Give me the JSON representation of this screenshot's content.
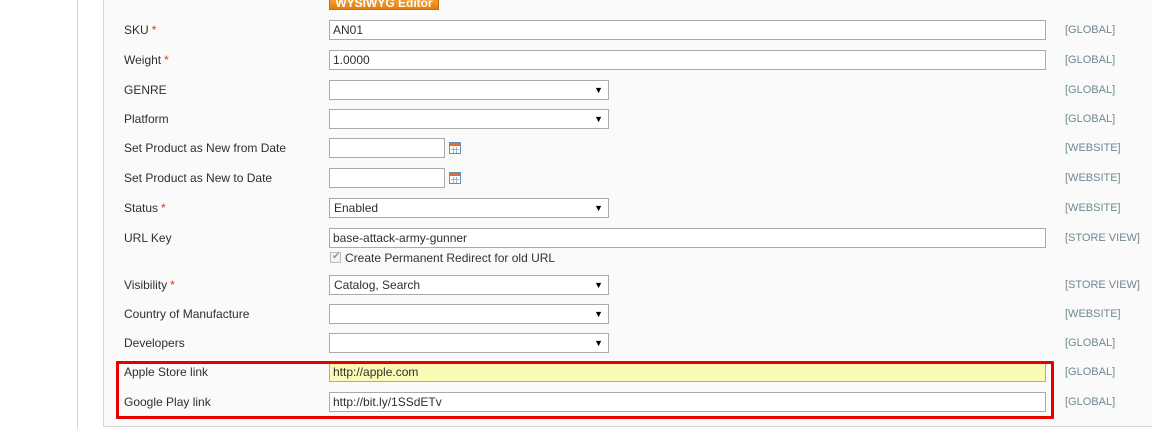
{
  "toolbar": {
    "wysiwyg_label": "WYSIWYG Editor"
  },
  "fields": {
    "sku": {
      "label": "SKU",
      "required": "*",
      "value": "AN01",
      "scope": "[GLOBAL]"
    },
    "weight": {
      "label": "Weight",
      "required": "*",
      "value": "1.0000",
      "scope": "[GLOBAL]"
    },
    "genre": {
      "label": "GENRE",
      "value": "",
      "scope": "[GLOBAL]"
    },
    "platform": {
      "label": "Platform",
      "value": "",
      "scope": "[GLOBAL]"
    },
    "new_from": {
      "label": "Set Product as New from Date",
      "value": "",
      "scope": "[WEBSITE]"
    },
    "new_to": {
      "label": "Set Product as New to Date",
      "value": "",
      "scope": "[WEBSITE]"
    },
    "status": {
      "label": "Status",
      "required": "*",
      "value": "Enabled",
      "scope": "[WEBSITE]"
    },
    "url_key": {
      "label": "URL Key",
      "value": "base-attack-army-gunner",
      "scope": "[STORE VIEW]",
      "redirect_label": "Create Permanent Redirect for old URL",
      "redirect_checked": true
    },
    "visibility": {
      "label": "Visibility",
      "required": "*",
      "value": "Catalog, Search",
      "scope": "[STORE VIEW]"
    },
    "country": {
      "label": "Country of Manufacture",
      "value": "",
      "scope": "[WEBSITE]"
    },
    "developers": {
      "label": "Developers",
      "value": "",
      "scope": "[GLOBAL]"
    },
    "apple_store": {
      "label": "Apple Store link",
      "value": "http://apple.com",
      "scope": "[GLOBAL]"
    },
    "google_play": {
      "label": "Google Play link",
      "value": "http://bit.ly/1SSdETv",
      "scope": "[GLOBAL]"
    }
  },
  "icons": {
    "dropdown_arrow": "▼",
    "calendar": "calendar-icon",
    "checkmark": "✔"
  },
  "colors": {
    "required_star": "#eb340a",
    "highlight_border": "#e80000",
    "highlight_input": "#fafab6",
    "wysiwyg_button": "#f18200"
  }
}
